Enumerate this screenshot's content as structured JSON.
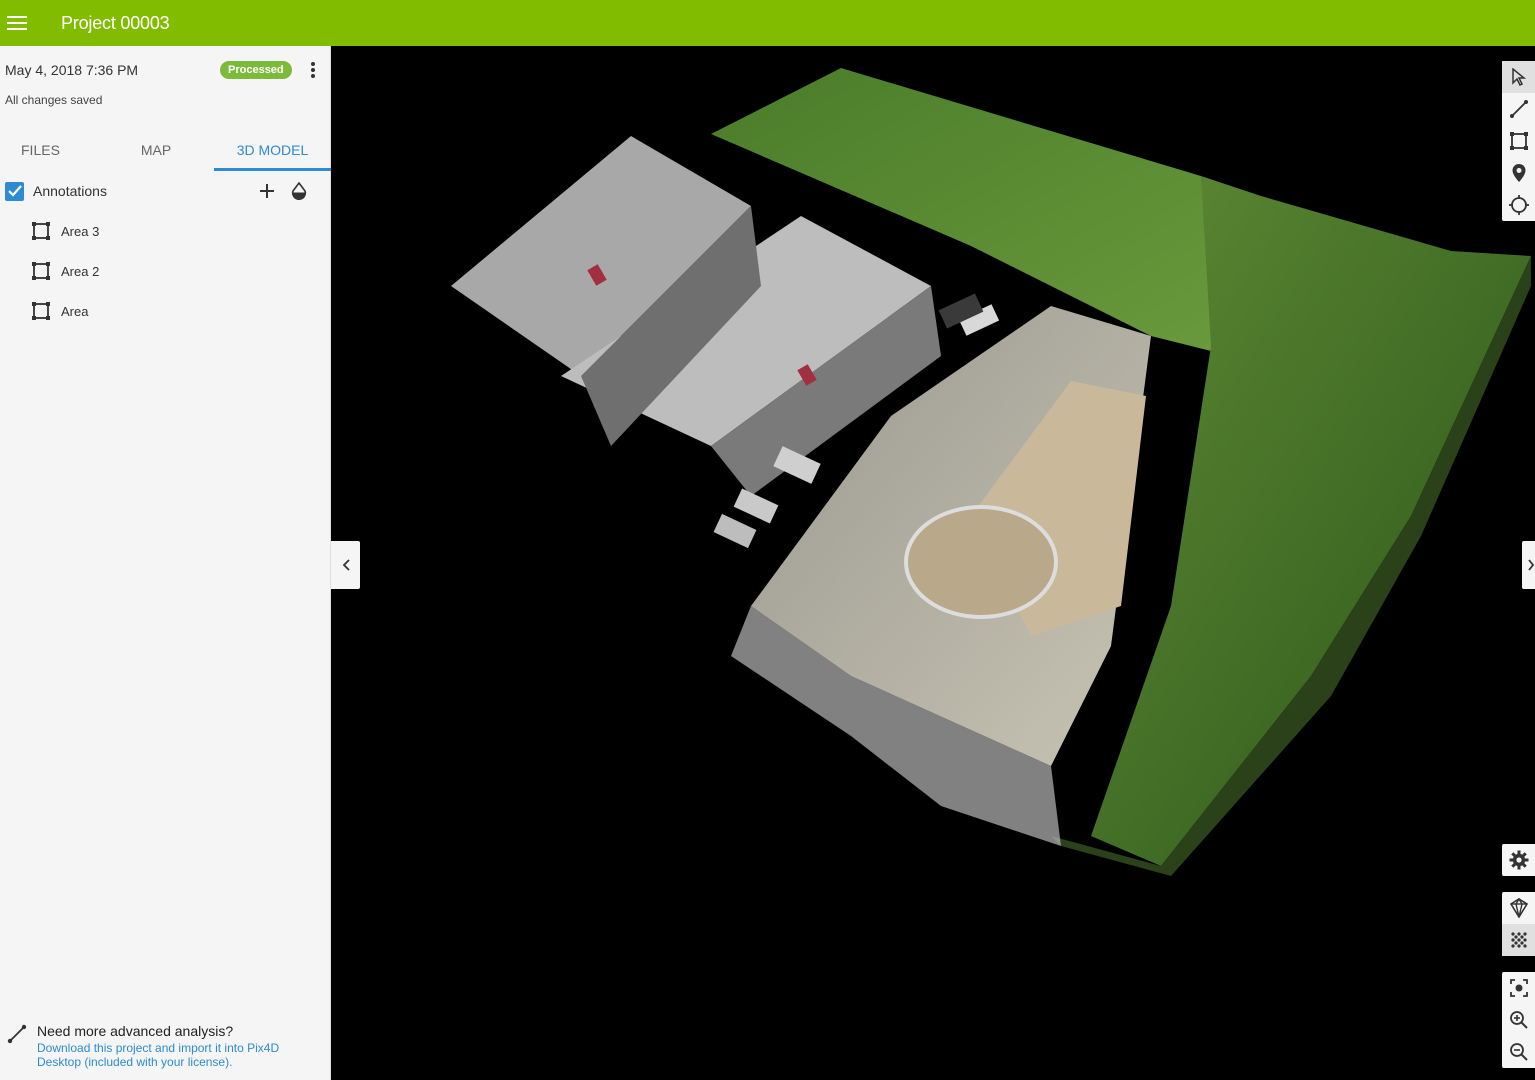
{
  "app": {
    "title": "Project 00003"
  },
  "project": {
    "date": "May 4, 2018 7:36 PM",
    "status": "Processed",
    "save_status": "All changes saved"
  },
  "tabs": [
    {
      "label": "FILES"
    },
    {
      "label": "MAP"
    },
    {
      "label": "3D MODEL"
    }
  ],
  "annotations": {
    "label": "Annotations",
    "checked": true,
    "items": [
      {
        "label": "Area 3",
        "icon": "area-icon"
      },
      {
        "label": "Area 2",
        "icon": "area-icon"
      },
      {
        "label": "Area",
        "icon": "area-icon"
      }
    ]
  },
  "footer": {
    "heading": "Need more advanced analysis?",
    "link": "Download this project and import it into Pix4D Desktop (included with your license)."
  },
  "colors": {
    "brand": "#82bc00",
    "accent": "#2d8bd1",
    "badge": "#7cba3a"
  },
  "toolbar_top": [
    "select-icon",
    "line-icon",
    "area-icon",
    "marker-icon",
    "target-icon"
  ],
  "toolbar_bottom": [
    "gear-icon",
    "diamond-icon",
    "point-cloud-icon",
    "focus-icon",
    "zoom-in-icon",
    "zoom-out-icon"
  ]
}
